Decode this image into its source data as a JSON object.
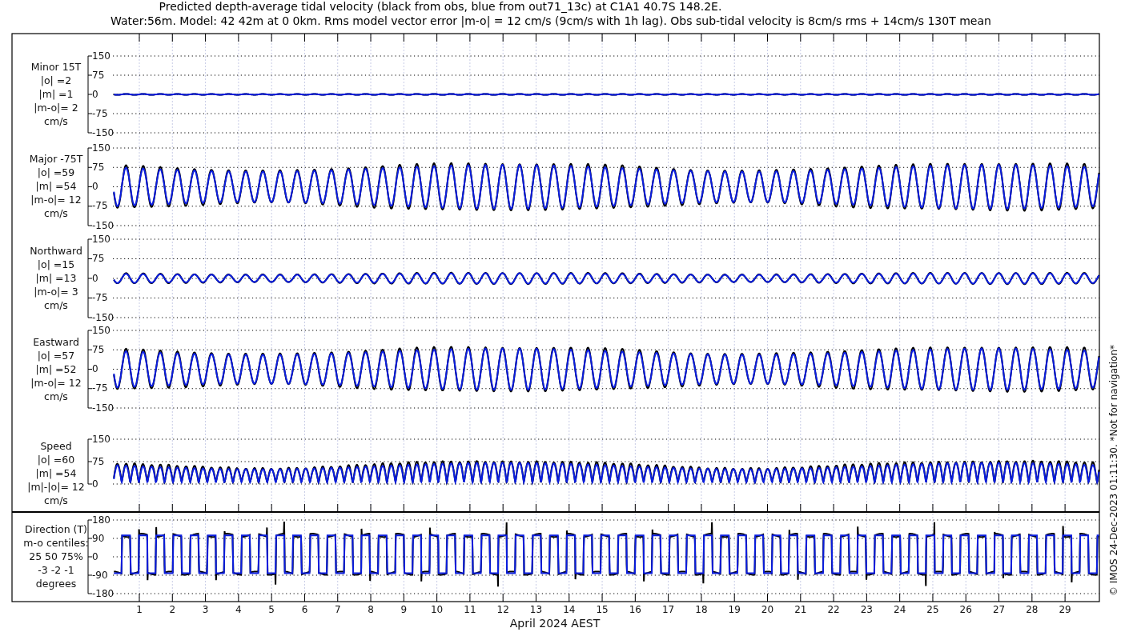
{
  "title": [
    "Predicted depth-average tidal velocity (black from obs, blue from out71_13c) at C1A1 40.7S 148.2E.",
    "Water:56m. Model: 42 42m at 0 0km. Rms model vector error |m-o| = 12 cm/s (9cm/s with 1h lag). Obs sub-tidal velocity is 8cm/s rms + 14cm/s 130T mean"
  ],
  "panels": [
    {
      "kind": "minor",
      "label": [
        "Minor 15T",
        "|o| =2",
        "|m| =1",
        "|m-o|= 2",
        "cm/s"
      ],
      "yticks": [
        "150",
        "75",
        "0",
        "-75",
        "-150"
      ]
    },
    {
      "kind": "major",
      "label": [
        "Major -75T",
        "|o| =59",
        "|m| =54",
        "|m-o|= 12",
        "cm/s"
      ],
      "yticks": [
        "150",
        "75",
        "0",
        "-75",
        "-150"
      ]
    },
    {
      "kind": "northward",
      "label": [
        "Northward",
        "|o| =15",
        "|m| =13",
        "|m-o|= 3",
        "cm/s"
      ],
      "yticks": [
        "150",
        "75",
        "0",
        "-75",
        "-150"
      ]
    },
    {
      "kind": "eastward",
      "label": [
        "Eastward",
        "|o| =57",
        "|m| =52",
        "|m-o|= 12",
        "cm/s"
      ],
      "yticks": [
        "150",
        "75",
        "0",
        "-75",
        "-150"
      ]
    },
    {
      "kind": "speed",
      "label": [
        "Speed",
        "|o| =60",
        "|m| =54",
        "|m|-|o|= 12",
        "cm/s"
      ],
      "yticks": [
        "150",
        "75",
        "0"
      ]
    },
    {
      "kind": "direction",
      "label": [
        "Direction (T)",
        "m-o centiles:",
        "25  50  75%",
        "-3 -2 -1",
        "degrees"
      ],
      "yticks": [
        "180",
        "90",
        "0",
        "-90",
        "-180"
      ]
    }
  ],
  "x_ticks": [
    "1",
    "2",
    "3",
    "4",
    "5",
    "6",
    "7",
    "8",
    "9",
    "10",
    "11",
    "12",
    "13",
    "14",
    "15",
    "16",
    "17",
    "18",
    "19",
    "20",
    "21",
    "22",
    "23",
    "24",
    "25",
    "26",
    "27",
    "28",
    "29"
  ],
  "xlabel": "April 2024 AEST",
  "footer": "© IMOS 24-Dec-2023 01:11:30. *Not for navigation*"
}
